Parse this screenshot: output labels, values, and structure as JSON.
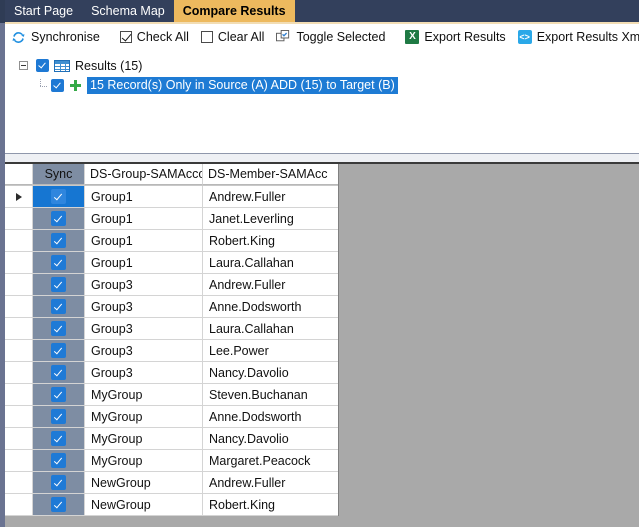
{
  "window": {
    "title": "Compare Results",
    "accent_tab_color": "#edb95e",
    "tabbar_color": "#33405c",
    "selection_color": "#1e7bd4"
  },
  "tabs": [
    {
      "label": "Start Page",
      "active": false
    },
    {
      "label": "Schema Map",
      "active": false
    },
    {
      "label": "Compare Results",
      "active": true
    }
  ],
  "toolbar": {
    "synchronise": {
      "label": "Synchronise",
      "icon": "refresh-icon"
    },
    "check_all": {
      "label": "Check All",
      "icon": "checkbox-checked-icon",
      "checked": true
    },
    "clear_all": {
      "label": "Clear All",
      "icon": "checkbox-empty-icon",
      "checked": false
    },
    "toggle_selected": {
      "label": "Toggle Selected",
      "icon": "toggle-windows-icon"
    },
    "export_results": {
      "label": "Export Results",
      "icon": "excel-icon",
      "icon_glyph": "X"
    },
    "export_results_xml": {
      "label": "Export Results Xml",
      "icon": "xml-icon",
      "icon_glyph": "<>"
    }
  },
  "tree": {
    "root": {
      "label": "Results (15)",
      "expander": "minus",
      "checked": true,
      "icon": "grid-table-icon",
      "selected": false
    },
    "child": {
      "label": "15 Record(s) Only in Source (A) ADD (15) to Target (B)",
      "checked": true,
      "icon": "plus-add-icon",
      "selected": true
    }
  },
  "grid": {
    "columns": [
      {
        "key": "rowhdr",
        "label": ""
      },
      {
        "key": "sync",
        "label": "Sync"
      },
      {
        "key": "group",
        "label": "DS-Group-SAMAcco"
      },
      {
        "key": "member",
        "label": "DS-Member-SAMAcc"
      }
    ],
    "rows": [
      {
        "current": true,
        "checked": true,
        "group": "Group1",
        "member": "Andrew.Fuller"
      },
      {
        "current": false,
        "checked": true,
        "group": "Group1",
        "member": "Janet.Leverling"
      },
      {
        "current": false,
        "checked": true,
        "group": "Group1",
        "member": "Robert.King"
      },
      {
        "current": false,
        "checked": true,
        "group": "Group1",
        "member": "Laura.Callahan"
      },
      {
        "current": false,
        "checked": true,
        "group": "Group3",
        "member": "Andrew.Fuller"
      },
      {
        "current": false,
        "checked": true,
        "group": "Group3",
        "member": "Anne.Dodsworth"
      },
      {
        "current": false,
        "checked": true,
        "group": "Group3",
        "member": "Laura.Callahan"
      },
      {
        "current": false,
        "checked": true,
        "group": "Group3",
        "member": "Lee.Power"
      },
      {
        "current": false,
        "checked": true,
        "group": "Group3",
        "member": "Nancy.Davolio"
      },
      {
        "current": false,
        "checked": true,
        "group": "MyGroup",
        "member": "Steven.Buchanan"
      },
      {
        "current": false,
        "checked": true,
        "group": "MyGroup",
        "member": "Anne.Dodsworth"
      },
      {
        "current": false,
        "checked": true,
        "group": "MyGroup",
        "member": "Nancy.Davolio"
      },
      {
        "current": false,
        "checked": true,
        "group": "MyGroup",
        "member": "Margaret.Peacock"
      },
      {
        "current": false,
        "checked": true,
        "group": "NewGroup",
        "member": "Andrew.Fuller"
      },
      {
        "current": false,
        "checked": true,
        "group": "NewGroup",
        "member": "Robert.King"
      }
    ]
  }
}
